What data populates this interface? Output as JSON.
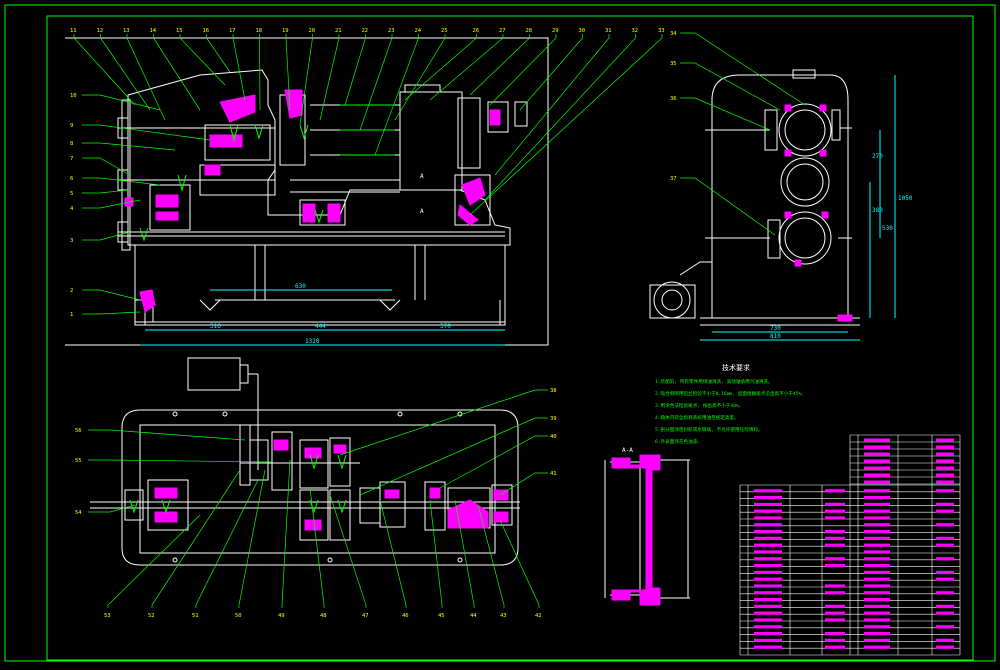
{
  "colors": {
    "background": "#000000",
    "frame": "#00ff00",
    "outline": "#ffffff",
    "section": "#ff00ff",
    "leader": "#00ff00",
    "label": "#ffff00",
    "dimension": "#00ffff",
    "text_note": "#00ff00"
  },
  "labels": {
    "top_row": [
      "11",
      "12",
      "13",
      "14",
      "15",
      "16",
      "17",
      "18",
      "19",
      "20",
      "21",
      "22",
      "23",
      "24",
      "25",
      "26",
      "27",
      "28",
      "29",
      "30",
      "31",
      "32",
      "33"
    ],
    "left_col": [
      "10",
      "9",
      "8",
      "7",
      "6",
      "5",
      "4",
      "3",
      "2",
      "1"
    ],
    "side_view": [
      "34",
      "35",
      "36",
      "37"
    ],
    "plan_left": [
      "56",
      "55",
      "54"
    ],
    "plan_right": [
      "38",
      "39",
      "40",
      "41"
    ],
    "plan_bottom": [
      "53",
      "52",
      "51",
      "50",
      "49",
      "48",
      "47",
      "46",
      "45",
      "44",
      "43",
      "42"
    ]
  },
  "dimensions": {
    "front_total": "1320",
    "front_span": "630",
    "front_a": "316",
    "front_b": "444",
    "front_c": "370",
    "side_w1": "730",
    "side_w2": "810",
    "side_h1": "270",
    "side_h2": "380",
    "side_h3": "1050",
    "side_h4": "530"
  },
  "views": {
    "section_aa": "A-A",
    "marker_a": "A"
  },
  "notes": {
    "title": "技术要求",
    "lines": [
      "1.装配前, 所有零件用煤油清洗, 滚动轴承用汽油清洗。",
      "2.啮合侧隙用铅丝检验不小于0.16mm, 齿面接触斑点沿齿高不小于45%。",
      "3.用涂色法检验斑点, 按齿高不小于40%。",
      "4.箱体内装全损耗系统用油至规定高度。",
      "5.剖分面涂密封胶或水玻璃, 不允许使用任何填料。",
      "6.外表面涂灰色油漆。"
    ]
  }
}
